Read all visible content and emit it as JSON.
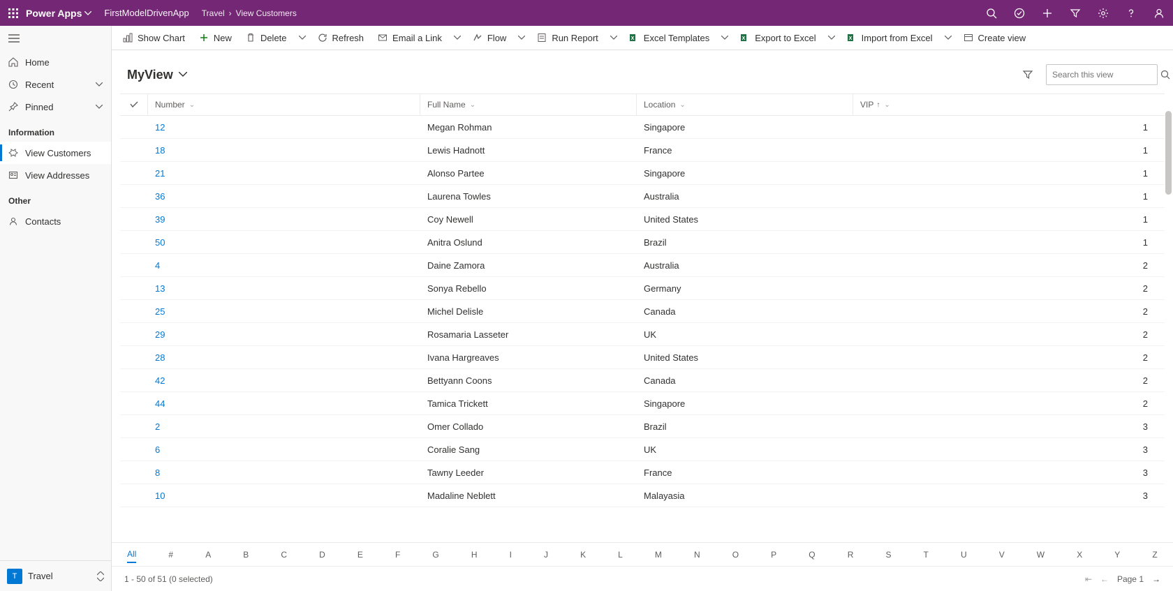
{
  "header": {
    "brand": "Power Apps",
    "app_name": "FirstModelDrivenApp",
    "breadcrumb": [
      "Travel",
      "View Customers"
    ]
  },
  "commands": {
    "show_chart": "Show Chart",
    "new": "New",
    "delete": "Delete",
    "refresh": "Refresh",
    "email_link": "Email a Link",
    "flow": "Flow",
    "run_report": "Run Report",
    "excel_templates": "Excel Templates",
    "export_excel": "Export to Excel",
    "import_excel": "Import from Excel",
    "create_view": "Create view"
  },
  "sidebar": {
    "home": "Home",
    "recent": "Recent",
    "pinned": "Pinned",
    "section_info": "Information",
    "view_customers": "View Customers",
    "view_addresses": "View Addresses",
    "section_other": "Other",
    "contacts": "Contacts",
    "area_tile": "T",
    "area_label": "Travel"
  },
  "view": {
    "title": "MyView",
    "search_placeholder": "Search this view"
  },
  "columns": {
    "number": "Number",
    "fullname": "Full Name",
    "location": "Location",
    "vip": "VIP"
  },
  "rows": [
    {
      "number": "12",
      "name": "Megan Rohman",
      "location": "Singapore",
      "vip": "1"
    },
    {
      "number": "18",
      "name": "Lewis Hadnott",
      "location": "France",
      "vip": "1"
    },
    {
      "number": "21",
      "name": "Alonso Partee",
      "location": "Singapore",
      "vip": "1"
    },
    {
      "number": "36",
      "name": "Laurena Towles",
      "location": "Australia",
      "vip": "1"
    },
    {
      "number": "39",
      "name": "Coy Newell",
      "location": "United States",
      "vip": "1"
    },
    {
      "number": "50",
      "name": "Anitra Oslund",
      "location": "Brazil",
      "vip": "1"
    },
    {
      "number": "4",
      "name": "Daine Zamora",
      "location": "Australia",
      "vip": "2"
    },
    {
      "number": "13",
      "name": "Sonya Rebello",
      "location": "Germany",
      "vip": "2"
    },
    {
      "number": "25",
      "name": "Michel Delisle",
      "location": "Canada",
      "vip": "2"
    },
    {
      "number": "29",
      "name": "Rosamaria Lasseter",
      "location": "UK",
      "vip": "2"
    },
    {
      "number": "28",
      "name": "Ivana Hargreaves",
      "location": "United States",
      "vip": "2"
    },
    {
      "number": "42",
      "name": "Bettyann Coons",
      "location": "Canada",
      "vip": "2"
    },
    {
      "number": "44",
      "name": "Tamica Trickett",
      "location": "Singapore",
      "vip": "2"
    },
    {
      "number": "2",
      "name": "Omer Collado",
      "location": "Brazil",
      "vip": "3"
    },
    {
      "number": "6",
      "name": "Coralie Sang",
      "location": "UK",
      "vip": "3"
    },
    {
      "number": "8",
      "name": "Tawny Leeder",
      "location": "France",
      "vip": "3"
    },
    {
      "number": "10",
      "name": "Madaline Neblett",
      "location": "Malayasia",
      "vip": "3"
    }
  ],
  "alphabet": [
    "All",
    "#",
    "A",
    "B",
    "C",
    "D",
    "E",
    "F",
    "G",
    "H",
    "I",
    "J",
    "K",
    "L",
    "M",
    "N",
    "O",
    "P",
    "Q",
    "R",
    "S",
    "T",
    "U",
    "V",
    "W",
    "X",
    "Y",
    "Z"
  ],
  "status": {
    "count_text": "1 - 50 of 51 (0 selected)",
    "page_label": "Page 1"
  },
  "colors": {
    "brand": "#742774",
    "accent": "#0078d4"
  }
}
